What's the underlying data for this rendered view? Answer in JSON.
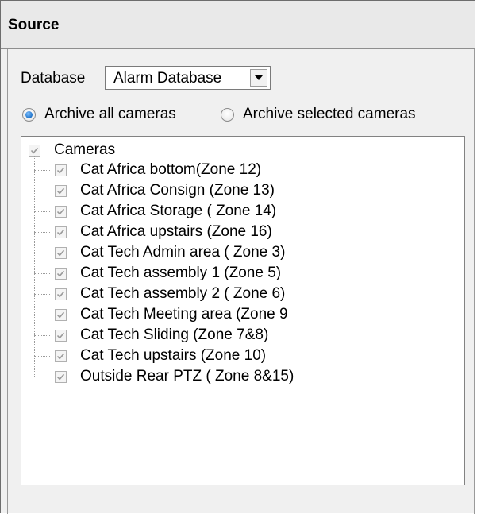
{
  "header": {
    "title": "Source"
  },
  "database": {
    "label": "Database",
    "selected": "Alarm Database"
  },
  "archive_options": [
    {
      "label": "Archive all cameras",
      "checked": true
    },
    {
      "label": "Archive selected cameras",
      "checked": false
    }
  ],
  "tree": {
    "root": {
      "label": "Cameras",
      "checked": true
    },
    "items": [
      {
        "label": "Cat Africa bottom(Zone 12)",
        "checked": true
      },
      {
        "label": "Cat Africa Consign (Zone 13)",
        "checked": true
      },
      {
        "label": "Cat Africa Storage ( Zone 14)",
        "checked": true
      },
      {
        "label": "Cat Africa upstairs (Zone 16)",
        "checked": true
      },
      {
        "label": "Cat Tech Admin area ( Zone 3)",
        "checked": true
      },
      {
        "label": "Cat Tech assembly 1 (Zone 5)",
        "checked": true
      },
      {
        "label": "Cat Tech assembly 2 ( Zone 6)",
        "checked": true
      },
      {
        "label": "Cat Tech Meeting area (Zone 9",
        "checked": true
      },
      {
        "label": "Cat Tech Sliding (Zone 7&8)",
        "checked": true
      },
      {
        "label": "Cat Tech upstairs  (Zone 10)",
        "checked": true
      },
      {
        "label": "Outside Rear PTZ ( Zone 8&15)",
        "checked": true
      }
    ]
  },
  "colors": {
    "radio_selected": "#1e72c8",
    "check_mark": "#9a9a9a"
  },
  "icons": {
    "dropdown": "chevron-down-icon",
    "check": "check-icon"
  }
}
